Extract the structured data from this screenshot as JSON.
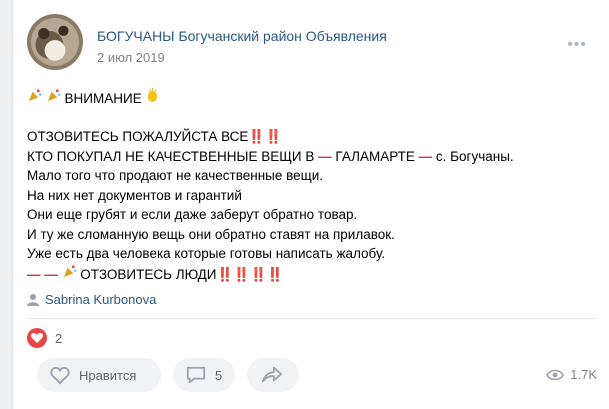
{
  "post": {
    "group_name": "БОГУЧАНЫ Богучанский район Объявления",
    "date": "2 июл 2019",
    "lines": {
      "l1": "ВНИМАНИЕ",
      "l2": "ОТЗОВИТЕСЬ ПОЖАЛУЙСТА ВСЕ",
      "l2_marks": "‼️‼️",
      "l3a": "КТО ПОКУПАЛ НЕ КАЧЕСТВЕННЫЕ ВЕЩИ В",
      "l3b": "ГАЛАМАРТЕ",
      "l3c": "с. Богучаны.",
      "l4": "Мало того что продают не качественные вещи.",
      "l5": "На них нет документов и гарантий",
      "l6": "Они еще грубят и если даже заберут обратно товар.",
      "l7": "И ту же сломанную вещь они обратно ставят на прилавок.",
      "l8": "Уже есть два человека которые готовы написать жалобу.",
      "l9": "ОТЗОВИТЕСЬ ЛЮДИ",
      "l9_marks": "‼️‼️‼️‼️"
    },
    "author": "Sabrina Kurbonova",
    "likes_count": "2",
    "like_label": "Нравится",
    "comments_count": "5",
    "views": "1.7K"
  },
  "colors": {
    "link": "#2a5885",
    "accent_red": "#e64646",
    "muted": "#828282"
  },
  "icons": [
    "more-icon",
    "party-horn-icon",
    "clap-icon",
    "double-exclamation-icon",
    "user-icon",
    "heart-icon",
    "comment-icon",
    "share-icon",
    "eye-icon"
  ]
}
